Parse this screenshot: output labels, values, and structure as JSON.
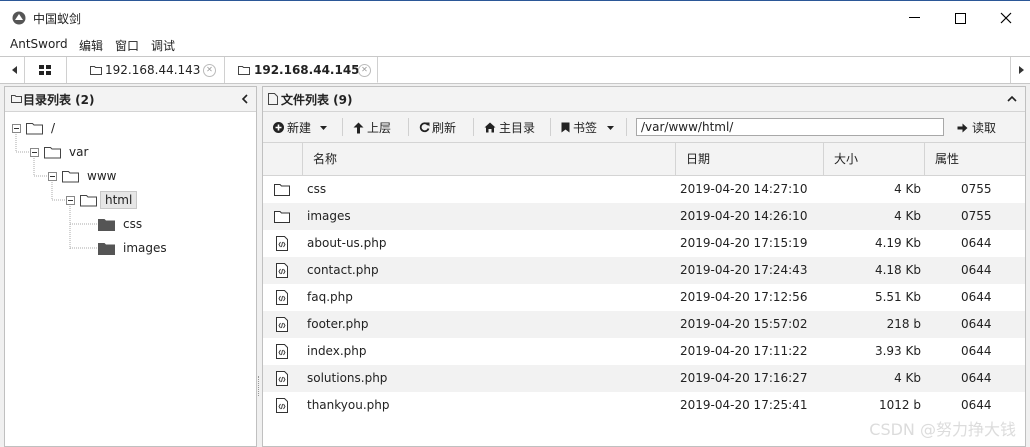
{
  "window": {
    "title": "中国蚁剑"
  },
  "menu": [
    "AntSword",
    "编辑",
    "窗口",
    "调试"
  ],
  "tabs": [
    {
      "label": "192.168.44.143",
      "active": false
    },
    {
      "label": "192.168.44.145",
      "active": true
    }
  ],
  "dir_panel": {
    "title": "目录列表 (2)",
    "nodes": [
      {
        "label": "/",
        "type": "open"
      },
      {
        "label": "var",
        "type": "open"
      },
      {
        "label": "www",
        "type": "open"
      },
      {
        "label": "html",
        "type": "open",
        "selected": true
      },
      {
        "label": "css",
        "type": "closed"
      },
      {
        "label": "images",
        "type": "closed"
      }
    ]
  },
  "file_panel": {
    "title": "文件列表 (9)",
    "toolbar": {
      "new": "新建",
      "up": "上层",
      "refresh": "刷新",
      "home": "主目录",
      "bookmark": "书签",
      "path": "/var/www/html/",
      "read": "读取"
    },
    "columns": [
      "名称",
      "日期",
      "大小",
      "属性"
    ],
    "files": [
      {
        "name": "css",
        "date": "2019-04-20 14:27:10",
        "size": "4 Kb",
        "perm": "0755",
        "icon": "folder-icon"
      },
      {
        "name": "images",
        "date": "2019-04-20 14:26:10",
        "size": "4 Kb",
        "perm": "0755",
        "icon": "folder-icon"
      },
      {
        "name": "about-us.php",
        "date": "2019-04-20 17:15:19",
        "size": "4.19 Kb",
        "perm": "0644",
        "icon": "code-file-icon"
      },
      {
        "name": "contact.php",
        "date": "2019-04-20 17:24:43",
        "size": "4.18 Kb",
        "perm": "0644",
        "icon": "code-file-icon"
      },
      {
        "name": "faq.php",
        "date": "2019-04-20 17:12:56",
        "size": "5.51 Kb",
        "perm": "0644",
        "icon": "code-file-icon"
      },
      {
        "name": "footer.php",
        "date": "2019-04-20 15:57:02",
        "size": "218 b",
        "perm": "0644",
        "icon": "code-file-icon"
      },
      {
        "name": "index.php",
        "date": "2019-04-20 17:11:22",
        "size": "3.93 Kb",
        "perm": "0644",
        "icon": "code-file-icon"
      },
      {
        "name": "solutions.php",
        "date": "2019-04-20 17:16:27",
        "size": "4 Kb",
        "perm": "0644",
        "icon": "code-file-icon"
      },
      {
        "name": "thankyou.php",
        "date": "2019-04-20 17:25:41",
        "size": "1012 b",
        "perm": "0644",
        "icon": "code-file-icon"
      }
    ]
  },
  "watermark": "CSDN @努力挣大钱"
}
